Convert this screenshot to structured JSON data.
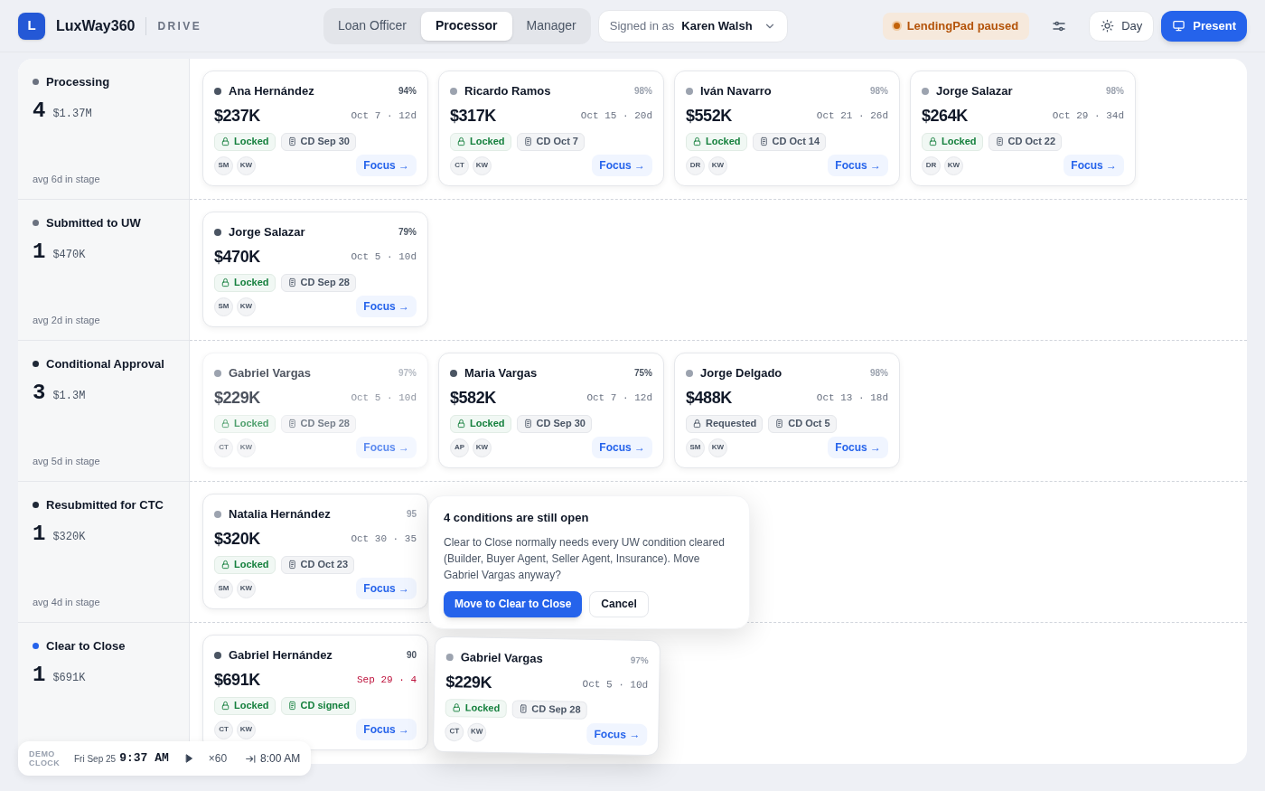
{
  "header": {
    "logo_letter": "L",
    "brand": "LuxWay360",
    "product": "DRIVE",
    "roles": [
      {
        "label": "Loan Officer",
        "selected": false
      },
      {
        "label": "Processor",
        "selected": true
      },
      {
        "label": "Manager",
        "selected": false
      }
    ],
    "signed_in": {
      "label": "Signed in as",
      "user": "Karen Walsh"
    },
    "sync_badge": "LendingPad paused",
    "theme_button": "Day",
    "present_button": "Present"
  },
  "stages": [
    {
      "name": "Processing",
      "color": "#6b7280",
      "count": "4",
      "amount": "$1.37M",
      "avg": "avg 6d in stage",
      "cards": [
        {
          "name": "Ana Hernández",
          "color": "#4b5563",
          "pct": "94%",
          "amount": "$237K",
          "date": "Oct 7 · 12d",
          "overdue": false,
          "ghost": false,
          "lock": {
            "kind": "locked",
            "label": "Locked"
          },
          "cd": {
            "kind": "scheduled",
            "label": "CD Sep 30"
          },
          "team": [
            "SM",
            "KW"
          ],
          "action": "Focus →"
        },
        {
          "name": "Ricardo Ramos",
          "color": "#9ca3af",
          "pct": "98%",
          "amount": "$317K",
          "date": "Oct 15 · 20d",
          "overdue": false,
          "ghost": false,
          "lock": {
            "kind": "locked",
            "label": "Locked"
          },
          "cd": {
            "kind": "scheduled",
            "label": "CD Oct 7"
          },
          "team": [
            "CT",
            "KW"
          ],
          "action": "Focus →"
        },
        {
          "name": "Iván Navarro",
          "color": "#9ca3af",
          "pct": "98%",
          "amount": "$552K",
          "date": "Oct 21 · 26d",
          "overdue": false,
          "ghost": false,
          "lock": {
            "kind": "locked",
            "label": "Locked"
          },
          "cd": {
            "kind": "scheduled",
            "label": "CD Oct 14"
          },
          "team": [
            "DR",
            "KW"
          ],
          "action": "Focus →"
        },
        {
          "name": "Jorge Salazar",
          "color": "#9ca3af",
          "pct": "98%",
          "amount": "$264K",
          "date": "Oct 29 · 34d",
          "overdue": false,
          "ghost": false,
          "lock": {
            "kind": "locked",
            "label": "Locked"
          },
          "cd": {
            "kind": "scheduled",
            "label": "CD Oct 22"
          },
          "team": [
            "DR",
            "KW"
          ],
          "action": "Focus →"
        }
      ]
    },
    {
      "name": "Submitted to UW",
      "color": "#6b7280",
      "count": "1",
      "amount": "$470K",
      "avg": "avg 2d in stage",
      "cards": [
        {
          "name": "Jorge Salazar",
          "color": "#4b5563",
          "pct": "79%",
          "amount": "$470K",
          "date": "Oct 5 · 10d",
          "overdue": false,
          "ghost": false,
          "lock": {
            "kind": "locked",
            "label": "Locked"
          },
          "cd": {
            "kind": "scheduled",
            "label": "CD Sep 28"
          },
          "team": [
            "SM",
            "KW"
          ],
          "action": "Focus →"
        }
      ]
    },
    {
      "name": "Conditional Approval",
      "color": "#1f2937",
      "count": "3",
      "amount": "$1.3M",
      "avg": "avg 5d in stage",
      "cards": [
        {
          "name": "Gabriel Vargas",
          "color": "#9ca3af",
          "pct": "97%",
          "amount": "$229K",
          "date": "Oct 5 · 10d",
          "overdue": false,
          "ghost": true,
          "lock": {
            "kind": "locked",
            "label": "Locked"
          },
          "cd": {
            "kind": "scheduled",
            "label": "CD Sep 28"
          },
          "team": [
            "CT",
            "KW"
          ],
          "action": "Focus →"
        },
        {
          "name": "Maria Vargas",
          "color": "#4b5563",
          "pct": "75%",
          "amount": "$582K",
          "date": "Oct 7 · 12d",
          "overdue": false,
          "ghost": false,
          "lock": {
            "kind": "locked",
            "label": "Locked"
          },
          "cd": {
            "kind": "scheduled",
            "label": "CD Sep 30"
          },
          "team": [
            "AP",
            "KW"
          ],
          "action": "Focus →"
        },
        {
          "name": "Jorge Delgado",
          "color": "#9ca3af",
          "pct": "98%",
          "amount": "$488K",
          "date": "Oct 13 · 18d",
          "overdue": false,
          "ghost": false,
          "lock": {
            "kind": "requested",
            "label": "Requested"
          },
          "cd": {
            "kind": "scheduled",
            "label": "CD Oct 5"
          },
          "team": [
            "SM",
            "KW"
          ],
          "action": "Focus →"
        }
      ]
    },
    {
      "name": "Resubmitted for CTC",
      "color": "#1f2937",
      "count": "1",
      "amount": "$320K",
      "avg": "avg 4d in stage",
      "cards": [
        {
          "name": "Natalia Hernández",
          "color": "#9ca3af",
          "pct": "95",
          "amount": "$320K",
          "date": "Oct 30 · 35",
          "overdue": false,
          "ghost": false,
          "lock": {
            "kind": "locked",
            "label": "Locked"
          },
          "cd": {
            "kind": "scheduled",
            "label": "CD Oct 23"
          },
          "team": [
            "SM",
            "KW"
          ],
          "action": "Focus →"
        }
      ]
    },
    {
      "name": "Clear to Close",
      "color": "#2563eb",
      "count": "1",
      "amount": "$691K",
      "cards": [
        {
          "name": "Gabriel Hernández",
          "color": "#4b5563",
          "pct": "90",
          "amount": "$691K",
          "date": "Sep 29 · 4",
          "overdue": true,
          "ghost": false,
          "lock": {
            "kind": "locked",
            "label": "Locked"
          },
          "cd": {
            "kind": "signed",
            "label": "CD signed"
          },
          "team": [
            "CT",
            "KW"
          ],
          "action": "Focus →"
        }
      ]
    }
  ],
  "popover": {
    "title": "4 conditions are still open",
    "body": "Clear to Close normally needs every UW condition cleared (Builder, Buyer Agent, Seller Agent, Insurance). Move Gabriel Vargas anyway?",
    "confirm": "Move to Clear to Close",
    "cancel": "Cancel"
  },
  "dragged_card": {
    "name": "Gabriel Vargas",
    "color": "#9ca3af",
    "pct": "97%",
    "amount": "$229K",
    "date": "Oct 5 · 10d",
    "overdue": false,
    "lock": {
      "kind": "locked",
      "label": "Locked"
    },
    "cd": {
      "kind": "scheduled",
      "label": "CD Sep 28"
    },
    "team": [
      "CT",
      "KW"
    ],
    "action": "Focus →"
  },
  "demo_clock": {
    "label": "DEMO CLOCK",
    "day": "Fri Sep 25",
    "time": "9:37 AM",
    "speed": "×60",
    "reset": "8:00 AM"
  }
}
